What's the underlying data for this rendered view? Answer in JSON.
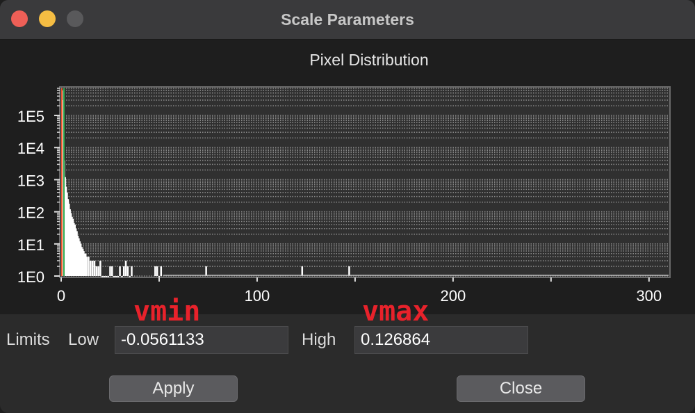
{
  "window": {
    "title": "Scale Parameters"
  },
  "chart_data": {
    "type": "bar",
    "title": "Pixel Distribution",
    "xlabel": "",
    "ylabel": "",
    "scale_y": "log",
    "xlim": [
      0,
      310
    ],
    "ylim": [
      1,
      700000
    ],
    "x_ticks": [
      0,
      100,
      200,
      300
    ],
    "x_tick_labels": [
      "0",
      "100",
      "200",
      "300"
    ],
    "y_ticks": [
      1,
      10,
      100,
      1000,
      10000,
      100000
    ],
    "y_tick_labels": [
      "1E0",
      "1E1",
      "1E2",
      "1E3",
      "1E4",
      "1E5"
    ],
    "grid": true,
    "limits": {
      "low": -0.0561133,
      "high": 0.126864
    },
    "series": [
      {
        "x": [
          0.5,
          1,
          1.5,
          2,
          2.5,
          3,
          3.5,
          4,
          4.5,
          5,
          5.5,
          6,
          6.5,
          7,
          7.5,
          8,
          8.5,
          9,
          9.5,
          10,
          10.5,
          11,
          11.5,
          12,
          12.5,
          13,
          14,
          15,
          16,
          17,
          18,
          19,
          20,
          21,
          22,
          23,
          24,
          25,
          26,
          27,
          28,
          29,
          30,
          31,
          32,
          33,
          34,
          35,
          36,
          48,
          49,
          50,
          51,
          74,
          123,
          147
        ],
        "values": [
          600000,
          300000,
          4000,
          1200,
          600,
          400,
          250,
          180,
          120,
          90,
          70,
          60,
          45,
          40,
          30,
          25,
          18,
          15,
          12,
          10,
          8,
          7,
          6,
          5,
          5,
          4,
          4,
          3,
          3,
          3,
          2,
          2,
          3,
          1,
          1,
          1,
          1,
          2,
          2,
          1,
          1,
          1,
          2,
          1,
          2,
          3,
          2,
          1,
          2,
          2,
          2,
          1,
          2,
          2,
          2,
          2
        ]
      }
    ]
  },
  "controls": {
    "limits_label": "Limits",
    "low_label": "Low",
    "low_value": "-0.0561133",
    "high_label": "High",
    "high_value": "0.126864",
    "apply_label": "Apply",
    "close_label": "Close"
  },
  "annotations": {
    "vmin": "vmin",
    "vmax": "vmax"
  },
  "colors": {
    "plot_bg": "#303030",
    "bars": "#ffffff",
    "grid": "#8a8a8a",
    "low_marker": "#e8552a",
    "high_marker": "#2fa84f",
    "annotation": "#e8222b"
  }
}
